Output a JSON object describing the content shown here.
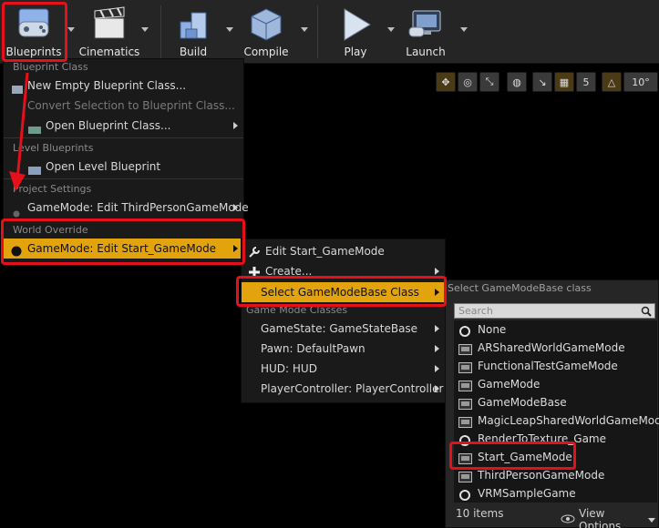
{
  "toolbar": {
    "buttons": [
      {
        "label": "Blueprints",
        "icon": "blueprints-controller-icon"
      },
      {
        "label": "Cinematics",
        "icon": "clapperboard-icon"
      },
      {
        "label": "Build",
        "icon": "build-blocks-icon"
      },
      {
        "label": "Compile",
        "icon": "compile-cube-icon"
      },
      {
        "label": "Play",
        "icon": "play-icon"
      },
      {
        "label": "Launch",
        "icon": "launch-monitor-icon"
      }
    ]
  },
  "viewport_tools": {
    "snap_value": "5",
    "angle_value": "10°"
  },
  "blueprints_menu": {
    "section_blueprint_class": "Blueprint Class",
    "new_empty": "New Empty Blueprint Class...",
    "convert_selection": "Convert Selection to Blueprint Class...",
    "open_class": "Open Blueprint Class...",
    "section_level": "Level Blueprints",
    "open_level": "Open Level Blueprint",
    "section_project": "Project Settings",
    "project_gamemode": "GameMode: Edit ThirdPersonGameMode",
    "section_world": "World Override",
    "world_gamemode": "GameMode: Edit Start_GameMode"
  },
  "gamemode_menu": {
    "edit": "Edit Start_GameMode",
    "create": "Create...",
    "select": "Select GameModeBase Class",
    "section_classes": "Game Mode Classes",
    "game_state": "GameState: GameStateBase",
    "pawn": "Pawn: DefaultPawn",
    "hud": "HUD: HUD",
    "player_controller": "PlayerController: PlayerController"
  },
  "picker": {
    "header": "Select GameModeBase class",
    "search_placeholder": "Search",
    "items": [
      {
        "label": "None",
        "icon": "none-circle-icon"
      },
      {
        "label": "ARSharedWorldGameMode",
        "icon": "class-icon"
      },
      {
        "label": "FunctionalTestGameMode",
        "icon": "class-icon"
      },
      {
        "label": "GameMode",
        "icon": "class-icon"
      },
      {
        "label": "GameModeBase",
        "icon": "class-icon"
      },
      {
        "label": "MagicLeapSharedWorldGameMode",
        "icon": "class-icon"
      },
      {
        "label": "RenderToTexture_Game",
        "icon": "blueprint-circle-icon"
      },
      {
        "label": "Start_GameMode",
        "icon": "class-icon"
      },
      {
        "label": "ThirdPersonGameMode",
        "icon": "class-icon"
      },
      {
        "label": "VRMSampleGame",
        "icon": "blueprint-circle-icon"
      }
    ],
    "count": "10 items",
    "view_options": "View Options"
  },
  "colors": {
    "accent": "#e3a30c",
    "highlight": "#e6101a",
    "menu_bg": "#1a1a1a"
  }
}
